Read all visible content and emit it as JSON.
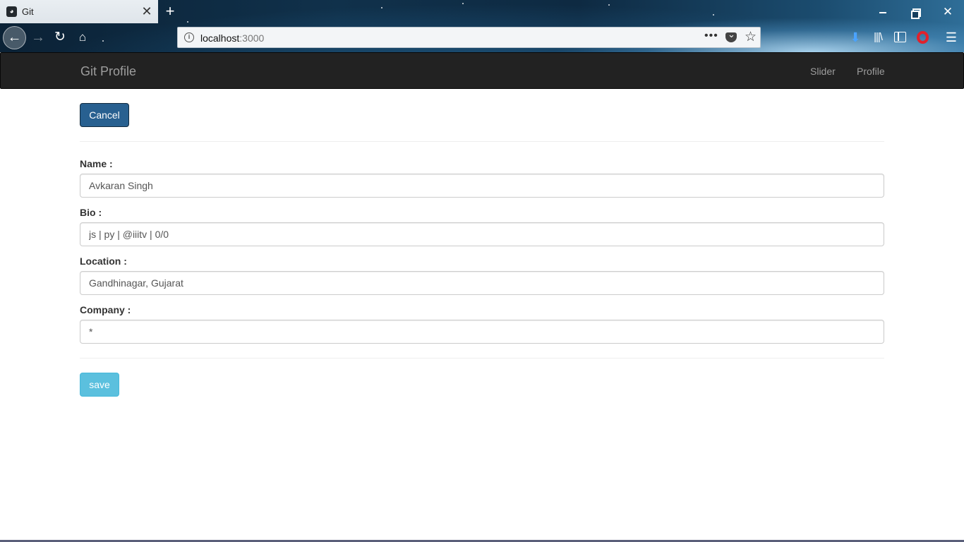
{
  "browser": {
    "tab_title": "Git",
    "tab_close": "✕",
    "new_tab": "+",
    "url_host": "localhost",
    "url_port": ":3000",
    "more": "•••",
    "icons": {
      "favicon": "github-icon",
      "back": "back-arrow-icon",
      "forward": "forward-arrow-icon",
      "reload": "reload-icon",
      "home": "home-icon",
      "info": "info-icon",
      "pocket": "pocket-icon",
      "bookmark": "star-icon",
      "download": "download-icon",
      "library": "library-icon",
      "sidebar": "sidebar-icon",
      "opera": "opera-icon",
      "menu": "hamburger-menu-icon"
    }
  },
  "navbar": {
    "brand": "Git Profile",
    "links": [
      "Slider",
      "Profile"
    ]
  },
  "form": {
    "cancel_label": "Cancel",
    "save_label": "save",
    "fields": [
      {
        "label": "Name :",
        "value": "Avkaran Singh"
      },
      {
        "label": "Bio :",
        "value": "js | py | @iiitv | 0/0"
      },
      {
        "label": "Location :",
        "value": "Gandhinagar, Gujarat"
      },
      {
        "label": "Company :",
        "value": "*"
      }
    ]
  },
  "colors": {
    "navbar_bg": "#222222",
    "navbar_text": "#9d9d9d",
    "primary": "#286090",
    "info": "#5bc0de"
  }
}
